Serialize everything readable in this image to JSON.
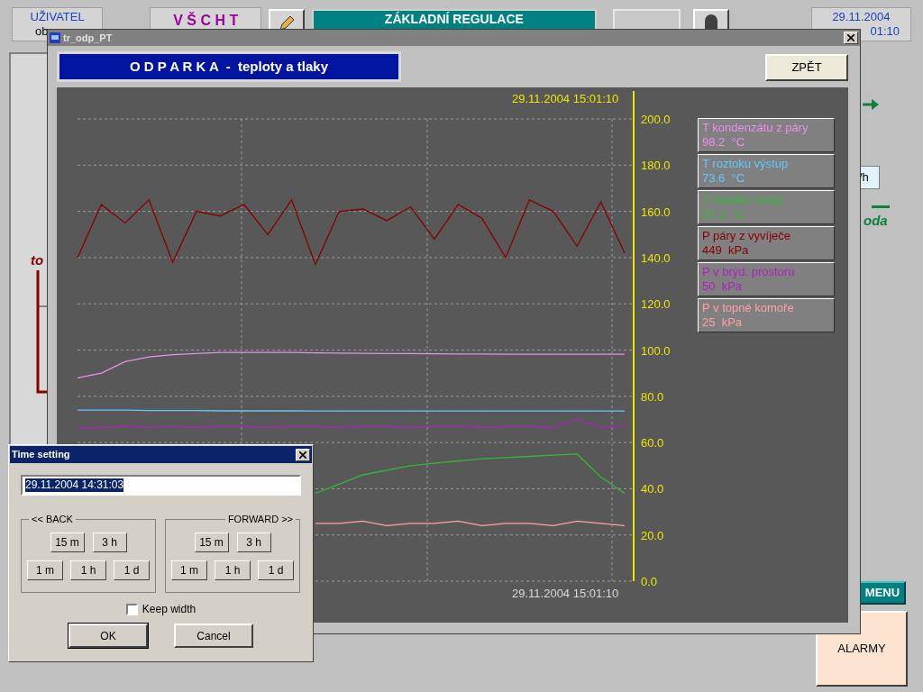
{
  "top_bar": {
    "user_label": "UŽIVATEL",
    "user_name": "ob",
    "logo": "V Š C H T",
    "screen_title": "ZÁKLADNÍ REGULACE",
    "date": "29.11.2004",
    "time": "01:10"
  },
  "background": {
    "left_label": "to",
    "flow_unit": "/h",
    "water_label": "oda",
    "menu_button": "MENU",
    "alarm_button": "ALARMY"
  },
  "window": {
    "title": "tr_odp_PT",
    "header": "O D P A R K A  -  teploty a tlaky",
    "back_button": "ZPĚT",
    "chart": {
      "time_top": "29.11.2004 15:01:10",
      "time_bottom": "29.11.2004 15:01:10",
      "legend": [
        {
          "name": "T kondenzátu z páry",
          "value": "98.2  °C",
          "color": "#e890e8"
        },
        {
          "name": "T roztoku výstup",
          "value": "73.6  °C",
          "color": "#60c8ff"
        },
        {
          "name": "T roztoku vstup",
          "value": "37.1  °C",
          "color": "#33bb33"
        },
        {
          "name": "P páry z vyvíječe",
          "value": "449  kPa",
          "color": "#880000"
        },
        {
          "name": "P v brýd. prostoru",
          "value": "50  kPa",
          "color": "#b020c0"
        },
        {
          "name": "P v topné komoře",
          "value": "25  kPa",
          "color": "#ffa0a0"
        }
      ],
      "chart_data": {
        "type": "line",
        "grid": true,
        "ylim": [
          0,
          200
        ],
        "yticks": [
          {
            "value": 0,
            "label": "0.0"
          },
          {
            "value": 20,
            "label": "20.0"
          },
          {
            "value": 40,
            "label": "40.0"
          },
          {
            "value": 60,
            "label": "60.0"
          },
          {
            "value": 80,
            "label": "80.0"
          },
          {
            "value": 100,
            "label": "100.0"
          },
          {
            "value": 120,
            "label": "120.0"
          },
          {
            "value": 140,
            "label": "140.0"
          },
          {
            "value": 160,
            "label": "160.0"
          },
          {
            "value": 180,
            "label": "180.0"
          },
          {
            "value": 200,
            "label": "200.0"
          }
        ],
        "series": [
          {
            "color": "#e890e8",
            "values": [
              88,
              90,
              95,
              97,
              98,
              98.5,
              99,
              99,
              99,
              99,
              98.8,
              98.7,
              98.6,
              98.5,
              98.5,
              98.4,
              98.3,
              98.3,
              98.2,
              98.2,
              98.2,
              98.2,
              98.2,
              98.2
            ]
          },
          {
            "color": "#60c8ff",
            "values": [
              74,
              74,
              74,
              73.8,
              73.8,
              73.8,
              73.7,
              73.7,
              73.7,
              73.7,
              73.6,
              73.6,
              73.6,
              73.6,
              73.6,
              73.6,
              73.6,
              73.6,
              73.6,
              73.6,
              73.6,
              73.6,
              73.6,
              73.6
            ]
          },
          {
            "color": "#33bb33",
            "values": [
              null,
              null,
              null,
              null,
              null,
              null,
              null,
              null,
              null,
              null,
              38,
              42,
              46,
              48,
              50,
              51,
              52,
              53,
              53.5,
              54,
              54.5,
              55,
              45,
              38
            ]
          },
          {
            "color": "#880000",
            "values": [
              140,
              163,
              155,
              165,
              138,
              160,
              158,
              163,
              150,
              165,
              137,
              160,
              161,
              156,
              162,
              148,
              163,
              157,
              140,
              165,
              160,
              145,
              164,
              142
            ]
          },
          {
            "color": "#b020c0",
            "values": [
              66,
              66.5,
              67,
              66.5,
              67,
              66.5,
              67,
              67,
              66.5,
              67,
              67,
              66.5,
              67,
              67,
              66.5,
              67,
              67,
              66.5,
              67,
              67,
              66.5,
              70,
              66.5,
              67
            ]
          },
          {
            "color": "#ffa0a0",
            "values": [
              null,
              null,
              null,
              null,
              null,
              null,
              null,
              null,
              null,
              null,
              25,
              25,
              26,
              24,
              25,
              25,
              26,
              24,
              25,
              25,
              24,
              26,
              25,
              24
            ]
          }
        ]
      }
    }
  },
  "dialog": {
    "title": "Time setting",
    "time_value": "29.11.2004 14:31:03",
    "groups": [
      {
        "label": "<< BACK",
        "top_buttons": [
          "15 m",
          "3 h"
        ],
        "bottom_buttons": [
          "1 m",
          "1 h",
          "1 d"
        ]
      },
      {
        "label": "FORWARD >>",
        "top_buttons": [
          "15 m",
          "3 h"
        ],
        "bottom_buttons": [
          "1 m",
          "1 h",
          "1 d"
        ]
      }
    ],
    "keep_width": {
      "label": "Keep width",
      "checked": false
    },
    "ok_button": "OK",
    "cancel_button": "Cancel"
  }
}
